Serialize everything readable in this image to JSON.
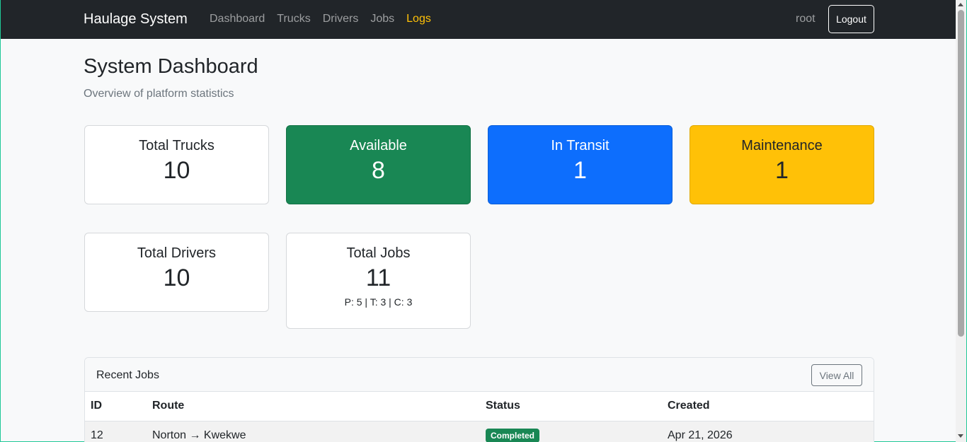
{
  "navbar": {
    "brand": "Haulage System",
    "links": [
      "Dashboard",
      "Trucks",
      "Drivers",
      "Jobs",
      "Logs"
    ],
    "active_link": "Logs",
    "user": "root",
    "logout_label": "Logout"
  },
  "page": {
    "title": "System Dashboard",
    "subtitle": "Overview of platform statistics"
  },
  "stats": {
    "total_trucks": {
      "label": "Total Trucks",
      "value": "10"
    },
    "available": {
      "label": "Available",
      "value": "8"
    },
    "in_transit": {
      "label": "In Transit",
      "value": "1"
    },
    "maintenance": {
      "label": "Maintenance",
      "value": "1"
    },
    "total_drivers": {
      "label": "Total Drivers",
      "value": "10"
    },
    "total_jobs": {
      "label": "Total Jobs",
      "value": "11",
      "breakdown": "P: 5 | T: 3 | C: 3"
    }
  },
  "recent_jobs": {
    "title": "Recent Jobs",
    "view_all_label": "View All",
    "columns": [
      "ID",
      "Route",
      "Status",
      "Created"
    ],
    "rows": [
      {
        "id": "12",
        "route": "Norton → Kwekwe",
        "status": "Completed",
        "created": "Apr 21, 2026"
      }
    ]
  },
  "colors": {
    "navbar_bg": "#212529",
    "active_link": "#ffc107",
    "available": "#198754",
    "in_transit": "#0d6efd",
    "maintenance": "#ffc107",
    "badge_completed": "#198754"
  }
}
